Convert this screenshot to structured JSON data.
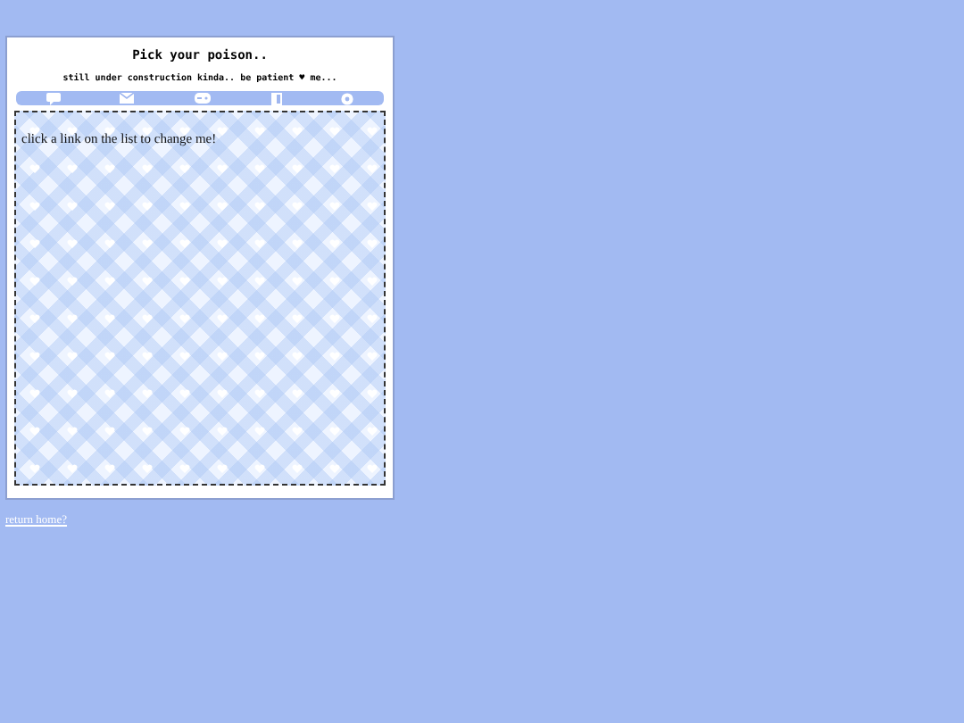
{
  "header": {
    "title": "Pick your poison..",
    "subtitle": "still under construction kinda.. be patient ♥ me..."
  },
  "nav_icons": [
    {
      "kind": "chat"
    },
    {
      "kind": "mail"
    },
    {
      "kind": "game"
    },
    {
      "kind": "book"
    },
    {
      "kind": "gear"
    }
  ],
  "content": {
    "text": "click a link on the list to change me!"
  },
  "footer_link": "return home?"
}
